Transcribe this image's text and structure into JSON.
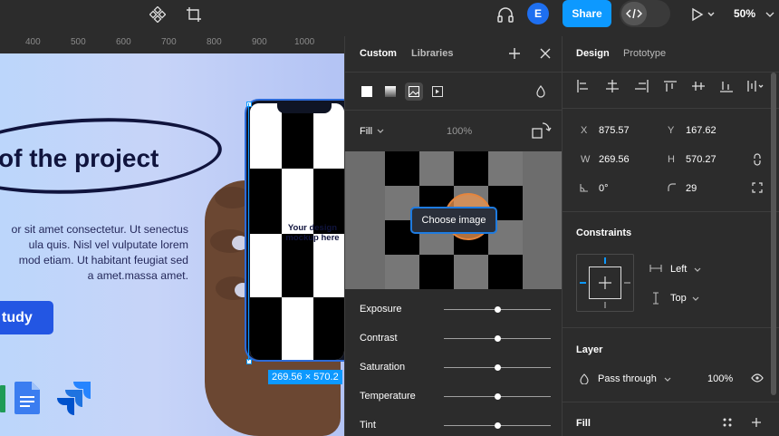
{
  "toolbar": {
    "share_label": "Share",
    "avatar_initial": "E",
    "zoom_label": "50%",
    "icons": [
      "component-icon",
      "crop-icon",
      "headphones-icon",
      "dev-mode-icon",
      "play-icon"
    ]
  },
  "ruler": {
    "ticks": [
      "400",
      "500",
      "600",
      "700",
      "800",
      "900",
      "1000"
    ]
  },
  "canvas": {
    "heading": "of the project",
    "body_text": "or sit amet consectetur. Ut senectus\nula quis. Nisl vel vulputate lorem\nmod etiam. Ut habitant feugiat sed\na amet.massa amet.",
    "cta_label": "tudy",
    "mockup_text": "Your design mockup here",
    "size_badge": "269.56 × 570.2",
    "app_icons": [
      "sheets-icon",
      "docs-icon",
      "jira-icon"
    ]
  },
  "fill_panel": {
    "tabs": [
      "Custom",
      "Libraries"
    ],
    "paint_types": [
      "solid-icon",
      "gradient-icon",
      "image-icon",
      "video-icon"
    ],
    "fill_mode": "Fill",
    "opacity": "100%",
    "choose_image_label": "Choose image",
    "adjustments": [
      {
        "label": "Exposure",
        "value": 0.5
      },
      {
        "label": "Contrast",
        "value": 0.5
      },
      {
        "label": "Saturation",
        "value": 0.5
      },
      {
        "label": "Temperature",
        "value": 0.5
      },
      {
        "label": "Tint",
        "value": 0.5
      }
    ]
  },
  "design_panel": {
    "tabs": [
      "Design",
      "Prototype"
    ],
    "x_label": "X",
    "x_value": "875.57",
    "y_label": "Y",
    "y_value": "167.62",
    "w_label": "W",
    "w_value": "269.56",
    "h_label": "H",
    "h_value": "570.27",
    "rotation": "0°",
    "corner_radius": "29",
    "constraints_title": "Constraints",
    "constraint_h": "Left",
    "constraint_v": "Top",
    "layer_title": "Layer",
    "blend_mode": "Pass through",
    "layer_opacity": "100%",
    "fill_title": "Fill"
  },
  "colors": {
    "accent": "#0d99ff",
    "panel_bg": "#2c2c2c",
    "heading_color": "#10143d",
    "cta_bg": "#2356e3"
  }
}
